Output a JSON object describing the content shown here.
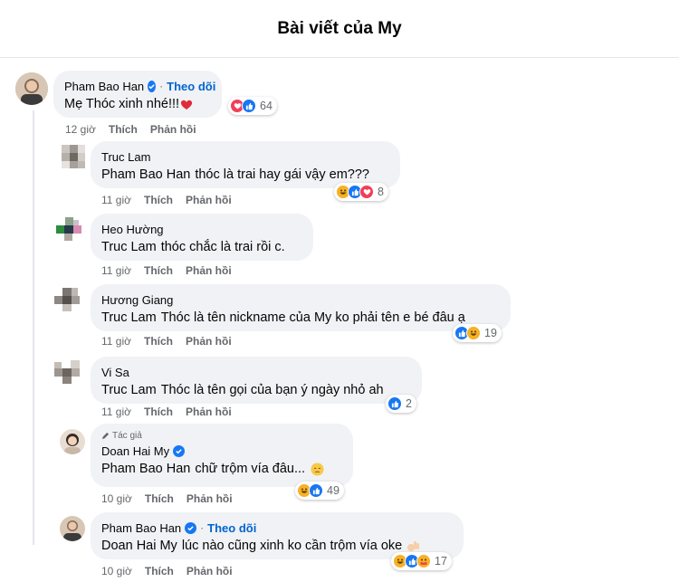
{
  "header": {
    "title": "Bài viết của My"
  },
  "comments": [
    {
      "author": "Pham Bao Han",
      "follow": "Theo dõi",
      "text": "Mẹ Thóc xinh nhé!!!",
      "time": "12 giờ",
      "like": "Thích",
      "reply": "Phản hồi",
      "reactions": "64"
    },
    {
      "author": "Truc Lam",
      "mention": "Pham Bao Han",
      "text": "thóc là trai hay gái vậy em???",
      "time": "11 giờ",
      "like": "Thích",
      "reply": "Phản hồi",
      "reactions": "8"
    },
    {
      "author": "Heo Hường",
      "mention": "Truc Lam",
      "text": "thóc chắc là trai rồi c.",
      "time": "11 giờ",
      "like": "Thích",
      "reply": "Phản hồi"
    },
    {
      "author": "Hương Giang",
      "mention": "Truc Lam",
      "text": "Thóc là tên nickname của My ko phải tên e bé đâu ạ",
      "time": "11 giờ",
      "like": "Thích",
      "reply": "Phản hồi",
      "reactions": "19"
    },
    {
      "author": "Vi Sa",
      "mention": "Truc Lam",
      "text": "Thóc là tên gọi của bạn ý ngày nhỏ ah",
      "time": "11 giờ",
      "like": "Thích",
      "reply": "Phản hồi",
      "reactions": "2"
    },
    {
      "author_tag": "Tác giả",
      "author": "Doan Hai My",
      "mention": "Pham Bao Han",
      "text": "chữ trộm vía đâu...",
      "time": "10 giờ",
      "like": "Thích",
      "reply": "Phản hồi",
      "reactions": "49"
    },
    {
      "author": "Pham Bao Han",
      "follow": "Theo dõi",
      "mention": "Doan Hai My",
      "text": "lúc nào cũng xinh ko cần trộm vía oke",
      "time": "10 giờ",
      "like": "Thích",
      "reply": "Phản hồi",
      "reactions": "17"
    }
  ],
  "colors": {
    "like": "#1877f2",
    "love": "#f33e58",
    "haha": "#f7b125",
    "bubble": "#f0f2f5",
    "follow": "#0064d1"
  }
}
